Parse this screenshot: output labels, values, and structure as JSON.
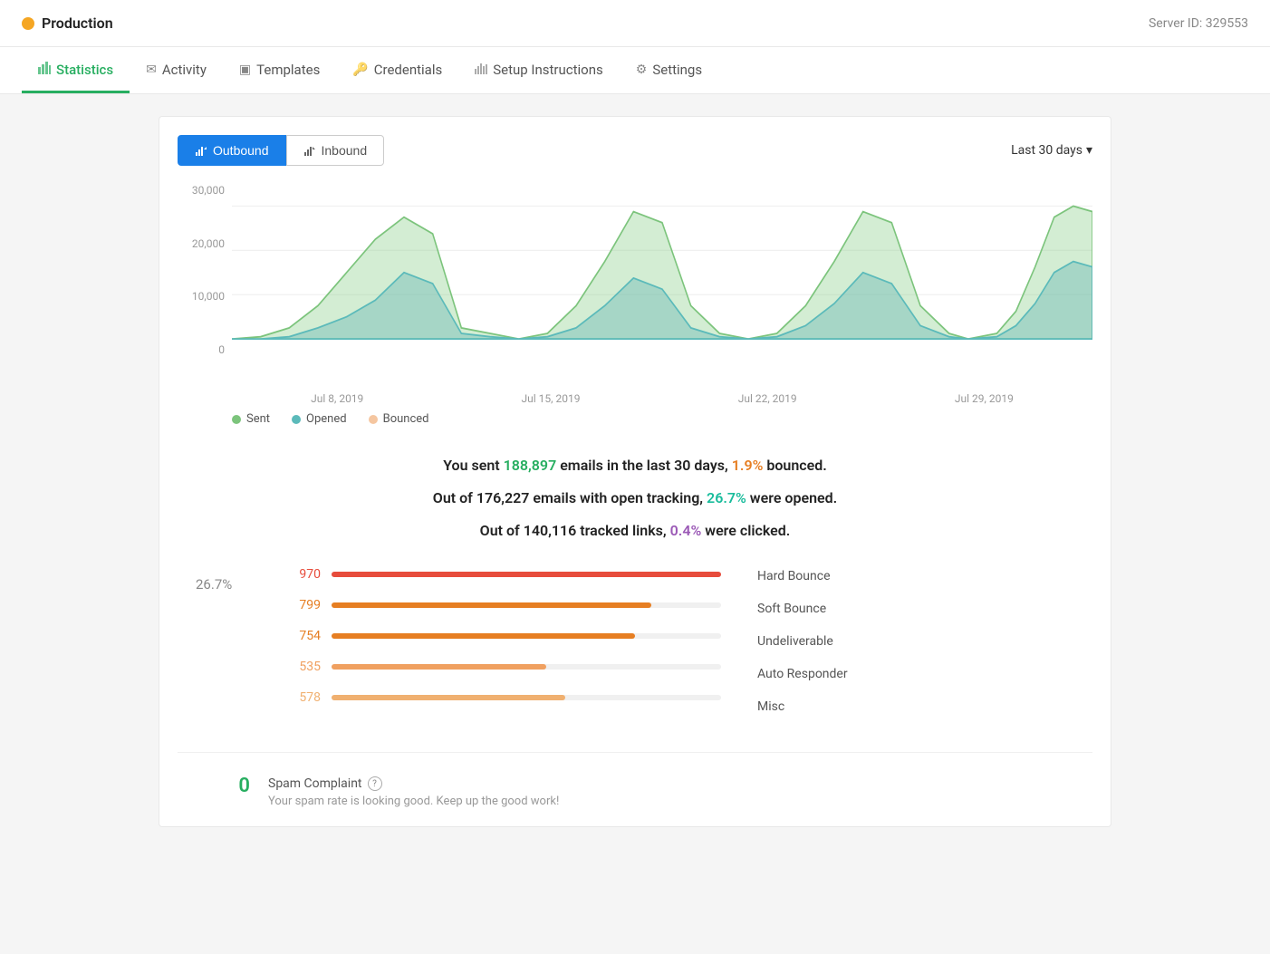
{
  "topbar": {
    "server_dot_color": "#f5a623",
    "server_name": "Production",
    "server_id_label": "Server ID: 329553"
  },
  "nav": {
    "items": [
      {
        "id": "statistics",
        "label": "Statistics",
        "icon": "bar-chart",
        "active": true
      },
      {
        "id": "activity",
        "label": "Activity",
        "icon": "mail",
        "active": false
      },
      {
        "id": "templates",
        "label": "Templates",
        "icon": "file",
        "active": false
      },
      {
        "id": "credentials",
        "label": "Credentials",
        "icon": "key",
        "active": false
      },
      {
        "id": "setup",
        "label": "Setup Instructions",
        "icon": "chart-bar",
        "active": false
      },
      {
        "id": "settings",
        "label": "Settings",
        "icon": "gear",
        "active": false
      }
    ]
  },
  "tabs": {
    "outbound_label": "Outbound",
    "inbound_label": "Inbound",
    "date_range_label": "Last 30 days"
  },
  "chart": {
    "y_labels": [
      "30,000",
      "20,000",
      "10,000",
      "0"
    ],
    "x_labels": [
      "Jul 8, 2019",
      "Jul 15, 2019",
      "Jul 22, 2019",
      "Jul 29, 2019"
    ],
    "legend": [
      {
        "label": "Sent",
        "color": "#a8d8a8"
      },
      {
        "label": "Opened",
        "color": "#7ecece"
      },
      {
        "label": "Bounced",
        "color": "#f5c6a0"
      }
    ]
  },
  "stats": {
    "line1_prefix": "You sent ",
    "sent_count": "188,897",
    "line1_middle": " emails in the last 30 days, ",
    "bounced_pct": "1.9%",
    "line1_suffix": " bounced.",
    "line2_prefix": "Out of ",
    "tracked_count": "176,227",
    "line2_middle": " emails with open tracking, ",
    "opened_pct": "26.7%",
    "line2_suffix": " were opened.",
    "line3_prefix": "Out of ",
    "links_count": "140,116",
    "line3_middle": " tracked links, ",
    "clicked_pct": "0.4%",
    "line3_suffix": " were clicked."
  },
  "open_rate": "26.7%",
  "bounce_items": [
    {
      "label": "Hard Bounce",
      "value": "970",
      "bar_pct": 100,
      "color": "#e74c3c"
    },
    {
      "label": "Soft Bounce",
      "value": "799",
      "bar_pct": 82,
      "color": "#e67e22"
    },
    {
      "label": "Undeliverable",
      "value": "754",
      "bar_pct": 78,
      "color": "#e67e22"
    },
    {
      "label": "Auto Responder",
      "value": "535",
      "bar_pct": 55,
      "color": "#f0a060"
    },
    {
      "label": "Misc",
      "value": "578",
      "bar_pct": 60,
      "color": "#f0b070"
    }
  ],
  "spam": {
    "count": "0",
    "title": "Spam Complaint",
    "help_icon": "?",
    "description": "Your spam rate is looking good. Keep up the good work!"
  }
}
